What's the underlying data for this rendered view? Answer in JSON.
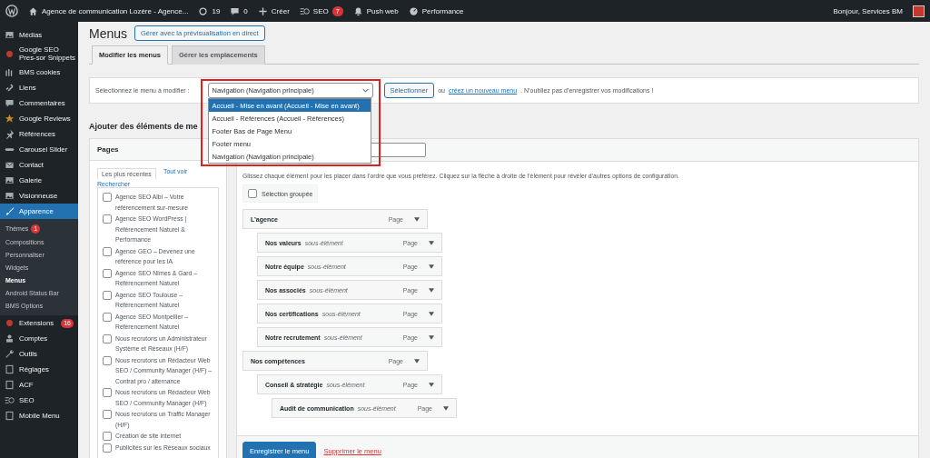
{
  "topbar": {
    "site_title": "Agence de communication Lozère - Agence...",
    "updates": "19",
    "comments": "0",
    "create": "Créer",
    "seo": "SEO",
    "seo_badge": "7",
    "push": "Push web",
    "performance": "Performance",
    "greeting": "Bonjour, Services BM"
  },
  "sidebar": {
    "items": [
      {
        "label": "Médias",
        "selected": false
      },
      {
        "label": "Google SEO Pres-sor Snippets",
        "selected": false
      },
      {
        "label": "BMS cookies",
        "selected": false
      },
      {
        "label": "Liens",
        "selected": false
      },
      {
        "label": "Commentaires",
        "selected": false
      },
      {
        "label": "Google Reviews",
        "selected": false
      },
      {
        "label": "Références",
        "selected": false
      },
      {
        "label": "Carousel Slider",
        "selected": false
      },
      {
        "label": "Contact",
        "selected": false
      },
      {
        "label": "Galerie",
        "selected": false
      },
      {
        "label": "Visionneuse",
        "selected": false
      },
      {
        "label": "Apparence",
        "selected": true,
        "submenu": [
          {
            "label": "Thèmes",
            "badge": "1",
            "selected": false
          },
          {
            "label": "Compositions",
            "selected": false
          },
          {
            "label": "Personnaliser",
            "selected": false
          },
          {
            "label": "Widgets",
            "selected": false
          },
          {
            "label": "Menus",
            "selected": true
          },
          {
            "label": "Android Status Bar",
            "selected": false
          },
          {
            "label": "BMS Options",
            "selected": false
          }
        ]
      },
      {
        "label": "Extensions",
        "badge": "16",
        "selected": false
      },
      {
        "label": "Comptes",
        "selected": false
      },
      {
        "label": "Outils",
        "selected": false
      },
      {
        "label": "Réglages",
        "selected": false
      },
      {
        "label": "ACF",
        "selected": false
      },
      {
        "label": "SEO",
        "selected": false
      },
      {
        "label": "Mobile Menu",
        "selected": false
      }
    ]
  },
  "page": {
    "title": "Menus",
    "live_preview_button": "Gérer avec la prévisualisation en direct"
  },
  "tabs": [
    {
      "label": "Modifier les menus",
      "selected": true
    },
    {
      "label": "Gérer les emplacements",
      "selected": false
    }
  ],
  "menu_select": {
    "label": "Sélectionnez le menu à modifier :",
    "value": "Navigation (Navigation principale)",
    "button": "Sélectionner",
    "or_text": "ou",
    "create_link": "créez un nouveau menu",
    "reminder": ". N’oubliez pas d’enregistrer vos modifications !",
    "options": [
      {
        "label": "Accueil - Mise en avant (Accueil - Mise en avant)",
        "highlighted": true
      },
      {
        "label": "Accueil - Références (Accueil - Références)",
        "highlighted": false
      },
      {
        "label": "Footer Bas de Page Menu",
        "highlighted": false
      },
      {
        "label": "Footer menu",
        "highlighted": false
      },
      {
        "label": "Navigation (Navigation principale)",
        "highlighted": false
      }
    ]
  },
  "add_items_heading": "Ajouter des éléments de me",
  "pages_panel": {
    "title": "Pages",
    "tabs": [
      {
        "label": "Les plus récentes",
        "selected": true
      },
      {
        "label": "Tout voir",
        "selected": false
      },
      {
        "label": "Rechercher",
        "selected": false
      }
    ],
    "items": [
      {
        "label": "Agence SEO Albi – Votre référencement sur-mesure",
        "checked": false
      },
      {
        "label": "Agence SEO WordPress | Référencement Naturel & Performance",
        "checked": false
      },
      {
        "label": "Agence GEO – Devenez une référence pour les IA",
        "checked": false
      },
      {
        "label": "Agence SEO Nîmes & Gard – Référencement Naturel",
        "checked": false
      },
      {
        "label": "Agence SEO Toulouse – Référencement Naturel",
        "checked": false
      },
      {
        "label": "Agence SEO Montpellier – Référencement Naturel",
        "checked": false
      },
      {
        "label": "Nous recrutons un Administrateur Système et Réseaux (H/F)",
        "checked": false
      },
      {
        "label": "Nous recrutons un Rédacteur Web SEO / Community Manager (H/F) – Contrat pro / alternance",
        "checked": false
      },
      {
        "label": "Nous recrutons un Rédacteur Web SEO / Community Manager (H/F)",
        "checked": false
      },
      {
        "label": "Nous recrutons un Traffic Manager (H/F)",
        "checked": false
      },
      {
        "label": "Création de site internet",
        "checked": false
      },
      {
        "label": "Publicités sur les Réseaux sociaux",
        "checked": false
      }
    ]
  },
  "structure": {
    "instructions": "Glissez chaque élément pour les placer dans l’ordre que vous préférez. Cliquez sur la flèche à droite de l’élément pour révéler d’autres options de configuration.",
    "bulk_select": {
      "label": "Sélection groupée",
      "checked": false
    },
    "items": [
      {
        "title": "L’agence",
        "type": "Page",
        "children": [
          {
            "title": "Nos valeurs",
            "note": "sous-élément",
            "type": "Page"
          },
          {
            "title": "Notre équipe",
            "note": "sous-élément",
            "type": "Page"
          },
          {
            "title": "Nos associés",
            "note": "sous-élément",
            "type": "Page"
          },
          {
            "title": "Nos certifications",
            "note": "sous-élément",
            "type": "Page"
          },
          {
            "title": "Notre recrutement",
            "note": "sous-élément",
            "type": "Page"
          }
        ]
      },
      {
        "title": "Nos compétences",
        "type": "Page",
        "children": [
          {
            "title": "Conseil & stratégie",
            "note": "sous-élément",
            "type": "Page",
            "children": [
              {
                "title": "Audit de communication",
                "note": "sous-élément",
                "type": "Page"
              }
            ]
          }
        ]
      }
    ],
    "save_button": "Enregistrer le menu",
    "delete_link": "Supprimer le menu"
  }
}
